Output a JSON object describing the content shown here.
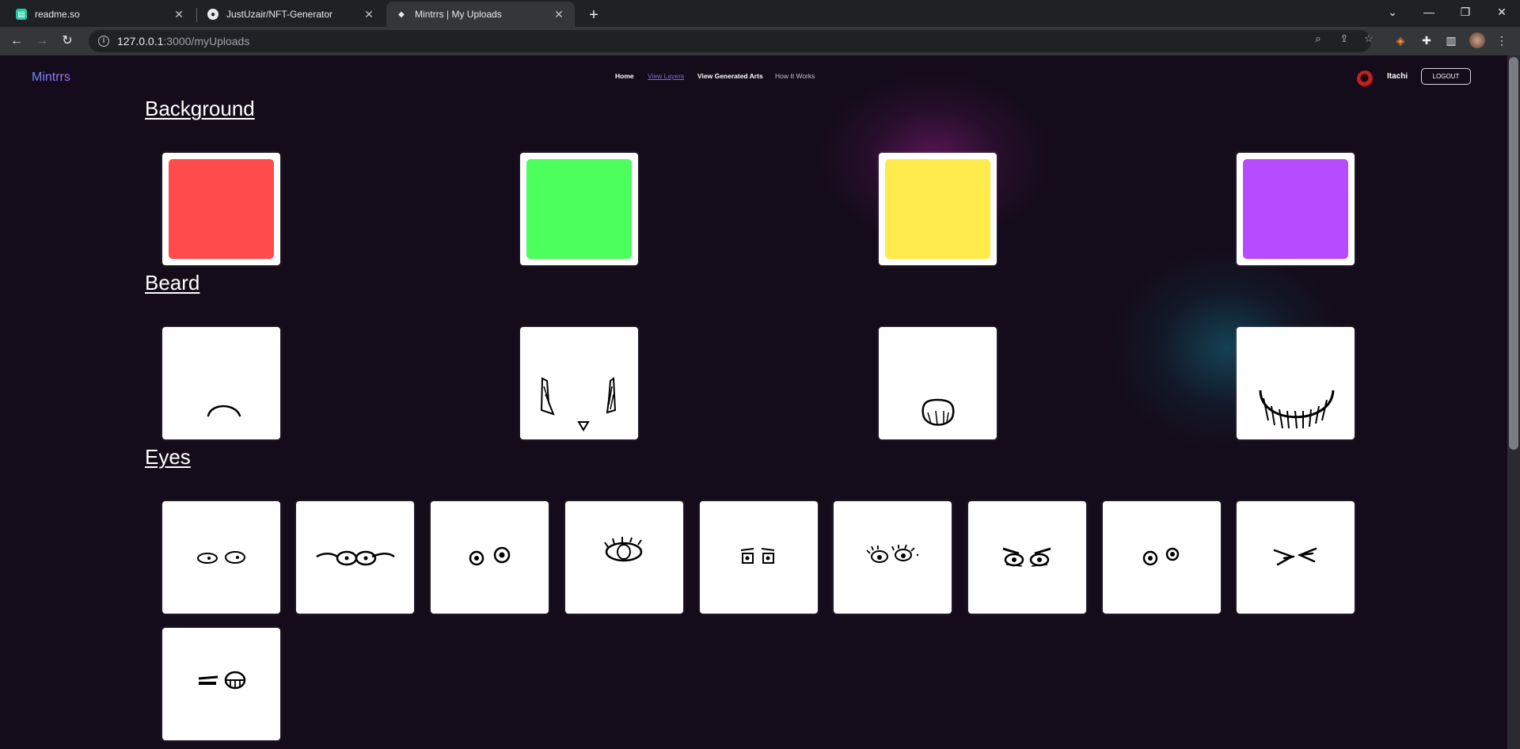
{
  "browser": {
    "tabs": [
      {
        "title": "readme.so",
        "favicon": "readme-icon",
        "active": false
      },
      {
        "title": "JustUzair/NFT-Generator",
        "favicon": "github-icon",
        "active": false
      },
      {
        "title": "Mintrrs | My Uploads",
        "favicon": "ethereum-icon",
        "active": true
      }
    ],
    "url_host": "127.0.0.1",
    "url_path": ":3000/myUploads"
  },
  "header": {
    "brand": "Mintrrs",
    "nav": [
      {
        "label": "Home"
      },
      {
        "label": "View Layers",
        "active": true
      },
      {
        "label": "View Generated Arts"
      },
      {
        "label": "How It Works"
      }
    ],
    "username": "Itachi",
    "logout_label": "LOGOUT"
  },
  "sections": [
    {
      "title": "Background",
      "items": [
        {
          "type": "color",
          "color": "#ff4b4b"
        },
        {
          "type": "color",
          "color": "#4cff5c"
        },
        {
          "type": "color",
          "color": "#ffeb4c"
        },
        {
          "type": "color",
          "color": "#b74bff"
        }
      ]
    },
    {
      "title": "Beard",
      "items": [
        {
          "type": "drawing",
          "icon": "beard-arc-icon"
        },
        {
          "type": "drawing",
          "icon": "beard-sideburns-icon"
        },
        {
          "type": "drawing",
          "icon": "beard-goatee-icon"
        },
        {
          "type": "drawing",
          "icon": "beard-full-icon"
        }
      ]
    },
    {
      "title": "Eyes",
      "items": [
        {
          "type": "drawing",
          "icon": "eyes-simple-icon"
        },
        {
          "type": "drawing",
          "icon": "eyes-glasses-icon"
        },
        {
          "type": "drawing",
          "icon": "eyes-round-icon"
        },
        {
          "type": "drawing",
          "icon": "eye-lashes-icon"
        },
        {
          "type": "drawing",
          "icon": "eyes-square-icon"
        },
        {
          "type": "drawing",
          "icon": "eyes-lashes-pair-icon"
        },
        {
          "type": "drawing",
          "icon": "eyes-angry-icon"
        },
        {
          "type": "drawing",
          "icon": "eyes-dots-icon"
        },
        {
          "type": "drawing",
          "icon": "eyes-squint-icon"
        },
        {
          "type": "drawing",
          "icon": "eyes-wink-icon"
        }
      ]
    }
  ]
}
